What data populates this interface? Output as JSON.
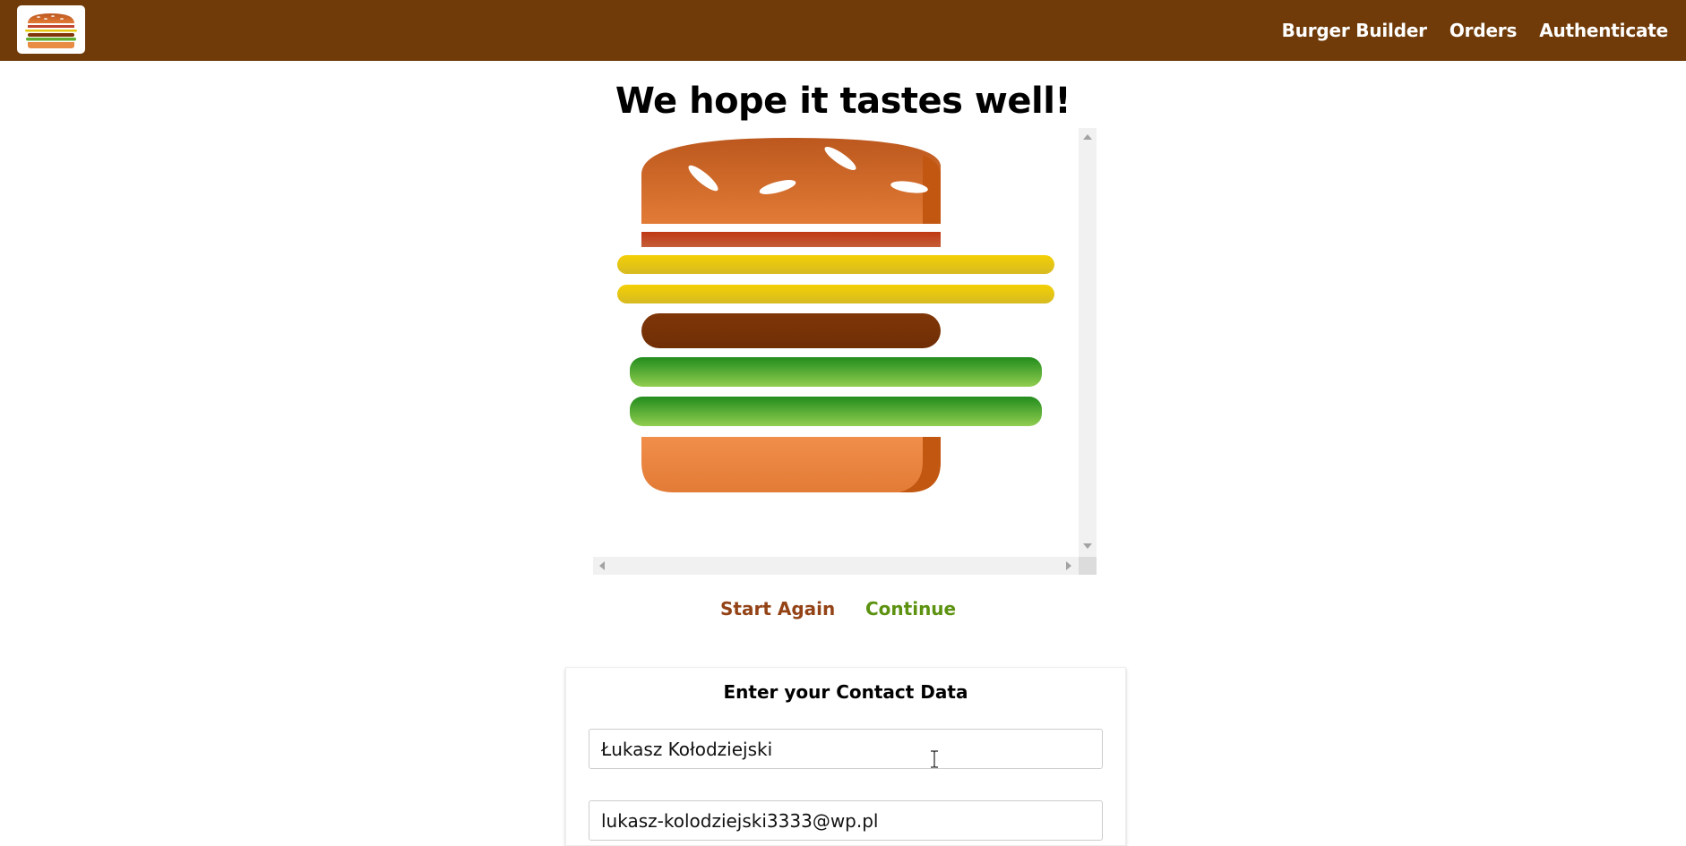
{
  "nav": {
    "logo_alt": "burger-logo",
    "items": [
      {
        "label": "Burger Builder"
      },
      {
        "label": "Orders"
      },
      {
        "label": "Authenticate"
      }
    ]
  },
  "checkout": {
    "title": "We hope it tastes well!",
    "ingredients": [
      "bread-top",
      "bacon",
      "cheese",
      "cheese",
      "meat",
      "salad",
      "salad",
      "bread-bottom"
    ],
    "start_again_label": "Start Again",
    "continue_label": "Continue"
  },
  "contact": {
    "title": "Enter your Contact Data",
    "name_value": "Łukasz Kołodziejski",
    "email_value": "lukasz-kolodziejski3333@wp.pl"
  },
  "colors": {
    "toolbar": "#703b09",
    "danger": "#944317",
    "success": "#5c9210"
  }
}
